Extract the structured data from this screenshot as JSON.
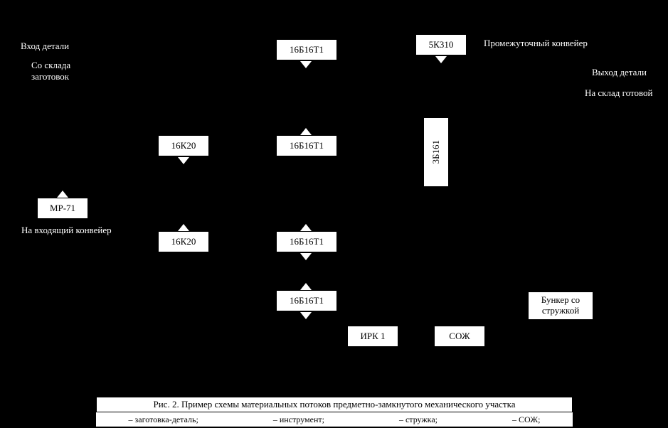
{
  "nodes": {
    "mp71": "МР-71",
    "k20_a": "16К20",
    "k20_b": "16К20",
    "b16t1_top": "16Б16Т1",
    "b16t1_mid": "16Б16Т1",
    "b16t1_low": "16Б16Т1",
    "b16t1_bot": "16Б16Т1",
    "k310": "5К310",
    "b161": "3Б161",
    "irk": "ИРК 1",
    "soj": "СОЖ",
    "bunker": "Бункер со стружкой"
  },
  "labels": {
    "vhod_detali": "Вход детали",
    "so_sklada": "Со склада заготовок",
    "na_vhod_konveer": "На входящий конвейер",
    "prom_konveer": "Промежуточный конвейер",
    "vyhod_detali": "Выход детали",
    "na_sklad": "На склад готовой"
  },
  "caption": "Рис. 2. Пример схемы материальных потоков предметно-замкнутого механического участка",
  "legend": {
    "zagotovka": "– заготовка-деталь;",
    "instrument": "– инструмент;",
    "struzhka": "– стружка;",
    "soj": "– СОЖ;"
  }
}
